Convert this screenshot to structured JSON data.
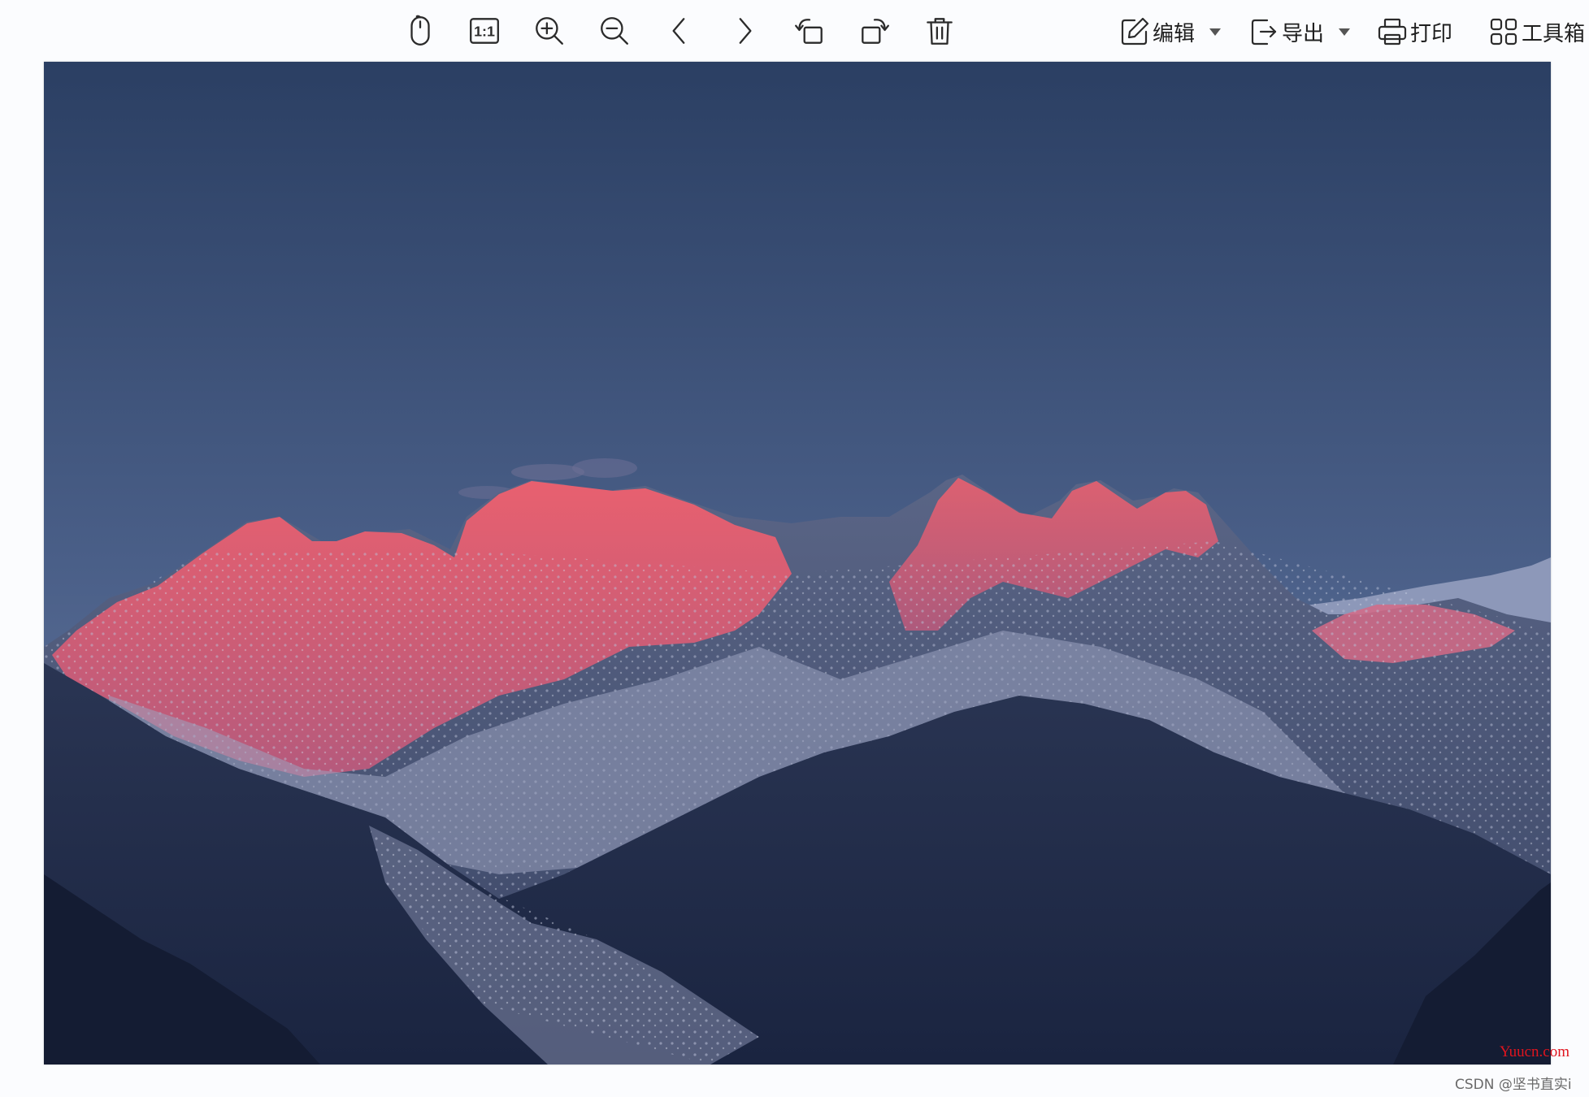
{
  "toolbar": {
    "icons": [
      {
        "name": "mouse-icon"
      },
      {
        "name": "actual-size-icon",
        "text": "1:1"
      },
      {
        "name": "zoom-in-icon"
      },
      {
        "name": "zoom-out-icon"
      },
      {
        "name": "previous-icon"
      },
      {
        "name": "next-icon"
      },
      {
        "name": "rotate-left-icon"
      },
      {
        "name": "rotate-right-icon"
      },
      {
        "name": "delete-icon"
      }
    ],
    "edit_label": "编辑",
    "export_label": "导出",
    "print_label": "打印",
    "toolbox_label": "工具箱"
  },
  "watermark": {
    "site": "Yuucn.com",
    "author": "CSDN @坚书直实i"
  },
  "colors": {
    "sky_top": "#2b3f63",
    "sky_bottom": "#6f7fa6",
    "alpenglow": "#e2566a",
    "forest": "#1f2b45",
    "snow": "#c9cde0"
  }
}
